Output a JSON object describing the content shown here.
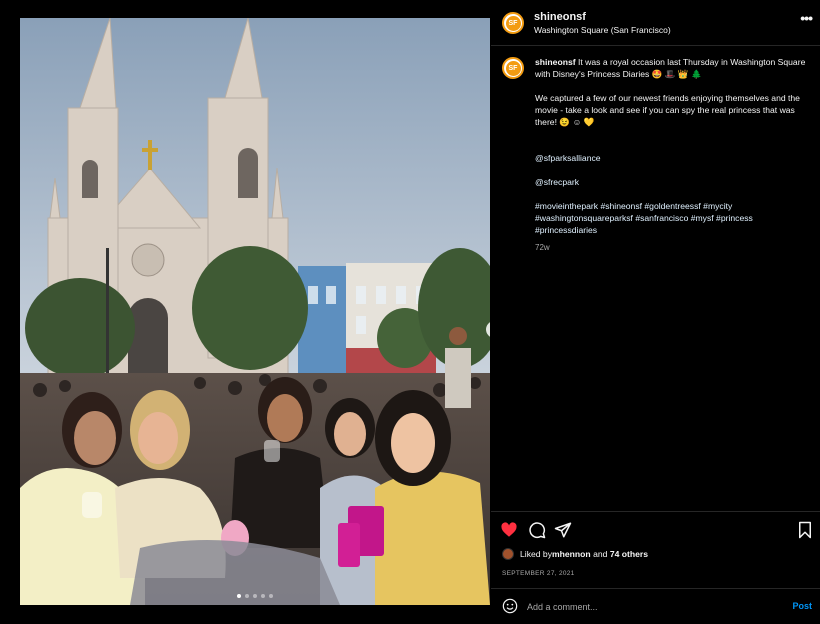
{
  "post": {
    "username": "shineonsf",
    "location": "Washington Square (San Francisco)",
    "avatar_text": "SF",
    "more_icon": "more-horizontal-icon"
  },
  "caption": {
    "username": "shineonsf",
    "text": "It was a royal occasion last Thursday in Washington Square with Disney's Princess Diaries 🤩 🎩 👑 🌲",
    "para2": "We captured a few of our newest friends enjoying themselves and the movie - take a look and see if you can spy the real princess that was there! 😉 ☺ 💛",
    "mention1": "@sfparksalliance",
    "mention2": "@sfrecpark",
    "hashtags": "#movieinthepark #shineonsf #goldentreessf #mycity #washingtonsquareparksf #sanfrancisco #mysf #princess #princessdiaries",
    "age": "72w"
  },
  "carousel": {
    "dot_count": 5,
    "active_dot": 0
  },
  "engagement": {
    "liked_by_prefix": "Liked by ",
    "liked_by_user": "mhennon",
    "liked_by_and": " and ",
    "liked_by_others": "74 others",
    "date": "SEPTEMBER 27, 2021",
    "heart_color": "#ff3040"
  },
  "comment": {
    "placeholder": "Add a comment...",
    "post_label": "Post",
    "post_color": "#0095f6"
  }
}
